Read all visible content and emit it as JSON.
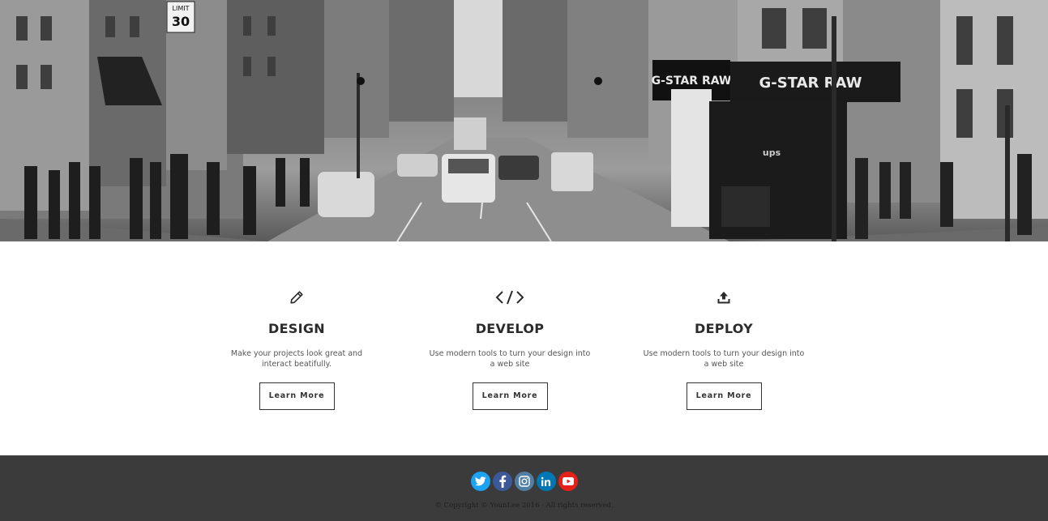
{
  "hero": {
    "signs": {
      "left_store": "G-STAR RAW",
      "right_store": "G-STAR RAW",
      "speed_limit_top": "LIMIT",
      "speed_limit_value": "30",
      "truck_brand": "ups"
    }
  },
  "features": [
    {
      "icon": "pencil-icon",
      "title": "DESIGN",
      "description": "Make your projects look great and interact beatifully.",
      "button_label": "Learn More"
    },
    {
      "icon": "code-icon",
      "title": "DEVELOP",
      "description": "Use modern tools to turn your design into a web site",
      "button_label": "Learn More"
    },
    {
      "icon": "upload-icon",
      "title": "DEPLOY",
      "description": "Use modern tools to turn your design into a web site",
      "button_label": "Learn More"
    }
  ],
  "footer": {
    "social": [
      {
        "name": "twitter-icon",
        "color": "#1da1f2"
      },
      {
        "name": "facebook-icon",
        "color": "#3b5998"
      },
      {
        "name": "instagram-icon",
        "color": "#517fa4"
      },
      {
        "name": "linkedin-icon",
        "color": "#0077b5"
      },
      {
        "name": "youtube-icon",
        "color": "#e62117"
      }
    ],
    "copyright": "© Copyright © YounLee 2016 · All rights reserved."
  },
  "colors": {
    "footer_bg": "#3b3b3b",
    "text_dark": "#2b2b2b",
    "text_muted": "#555555"
  }
}
